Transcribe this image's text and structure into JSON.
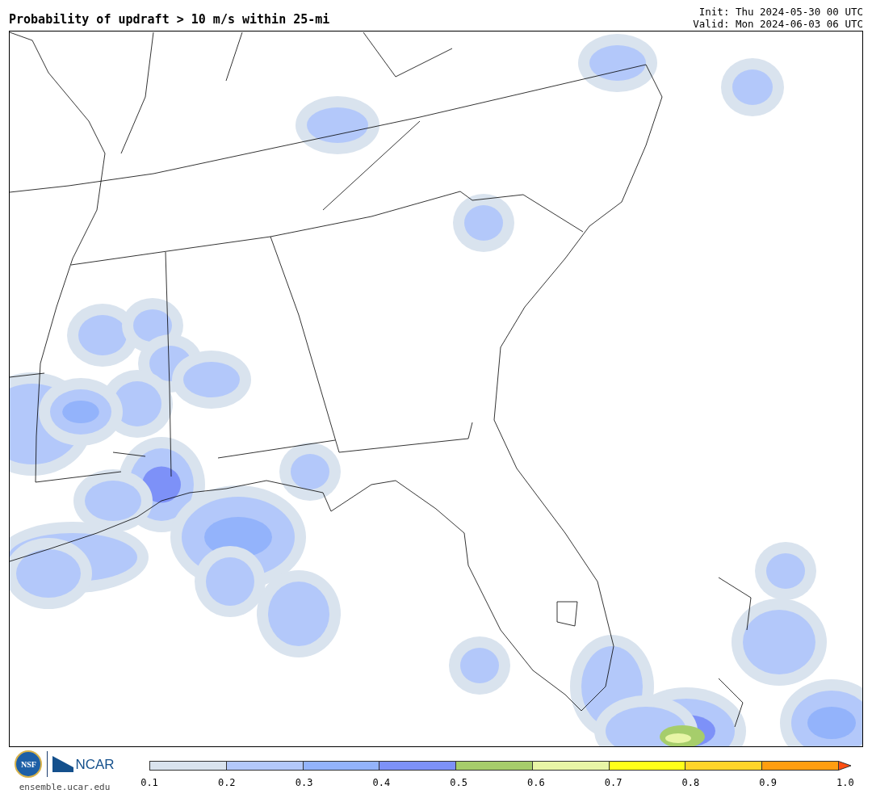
{
  "title": "Probability of updraft > 10 m/s within 25-mi",
  "init": "Init: Thu 2024-05-30 00 UTC",
  "valid": "Valid: Mon 2024-06-03 06 UTC",
  "logo": {
    "nsf": "NSF",
    "ncar": "NCAR",
    "url": "ensemble.ucar.edu"
  },
  "colorbar": {
    "segments": [
      {
        "kind": "bin",
        "color": "#d9e3ee"
      },
      {
        "kind": "bin",
        "color": "#b3c8fa"
      },
      {
        "kind": "bin",
        "color": "#93b3fb"
      },
      {
        "kind": "bin",
        "color": "#7d91f8"
      },
      {
        "kind": "bin",
        "color": "#a6cd6b"
      },
      {
        "kind": "bin",
        "color": "#e8f5a6"
      },
      {
        "kind": "bin",
        "color": "#ffff1a"
      },
      {
        "kind": "bin",
        "color": "#ffd52a"
      },
      {
        "kind": "bin",
        "color": "#ff9e10"
      },
      {
        "kind": "arrow",
        "color": "#ff4e10"
      }
    ],
    "ticks": [
      "0.1",
      "0.2",
      "0.3",
      "0.4",
      "0.5",
      "0.6",
      "0.7",
      "0.8",
      "0.9",
      "1.0"
    ]
  }
}
